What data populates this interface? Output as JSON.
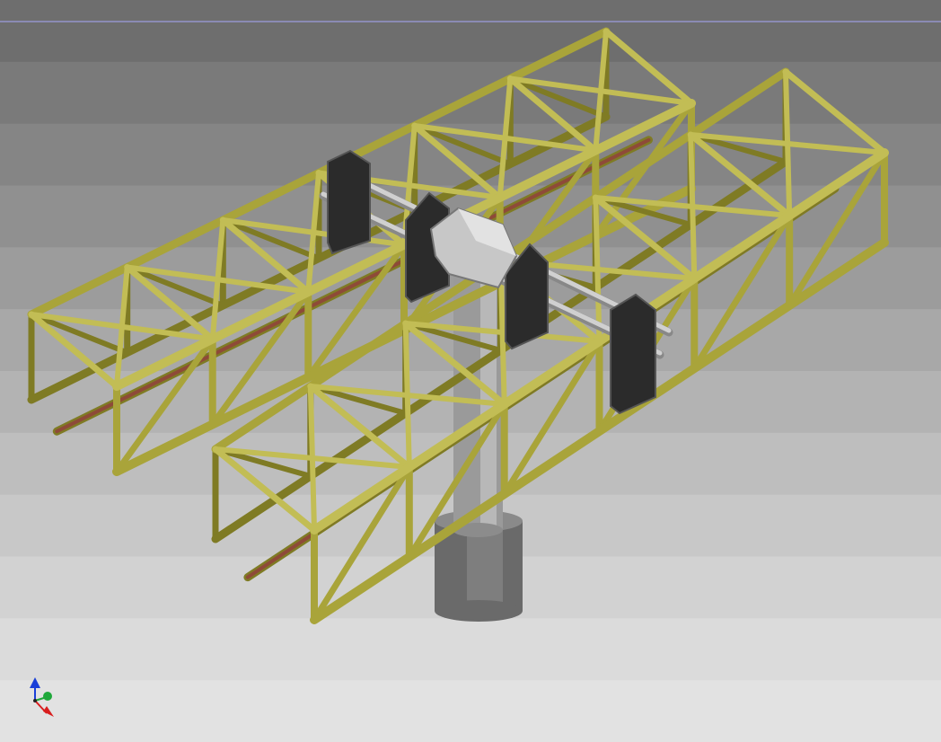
{
  "viewport": {
    "background_bands": [
      "#6e6e6e",
      "#7a7a7a",
      "#858585",
      "#909090",
      "#9c9c9c",
      "#a8a8a8",
      "#b3b3b3",
      "#bebebe",
      "#c8c8c8",
      "#d2d2d2",
      "#dbdbdb",
      "#e2e2e2"
    ],
    "top_line_color": "#8a8ab4"
  },
  "model": {
    "truss_color": "#a9a43a",
    "truss_dark": "#7f7b24",
    "truss_light": "#c2bd55",
    "rail_color": "#8e4a38",
    "column_color": "#9a9a9a",
    "column_dark": "#6a6a6a",
    "plate_color": "#2b2b2b",
    "shaft_color": "#d0d0d0"
  },
  "triad": {
    "z_color": "#1a3fd8",
    "y_color": "#1fa83a",
    "x_color": "#d81e1e"
  }
}
